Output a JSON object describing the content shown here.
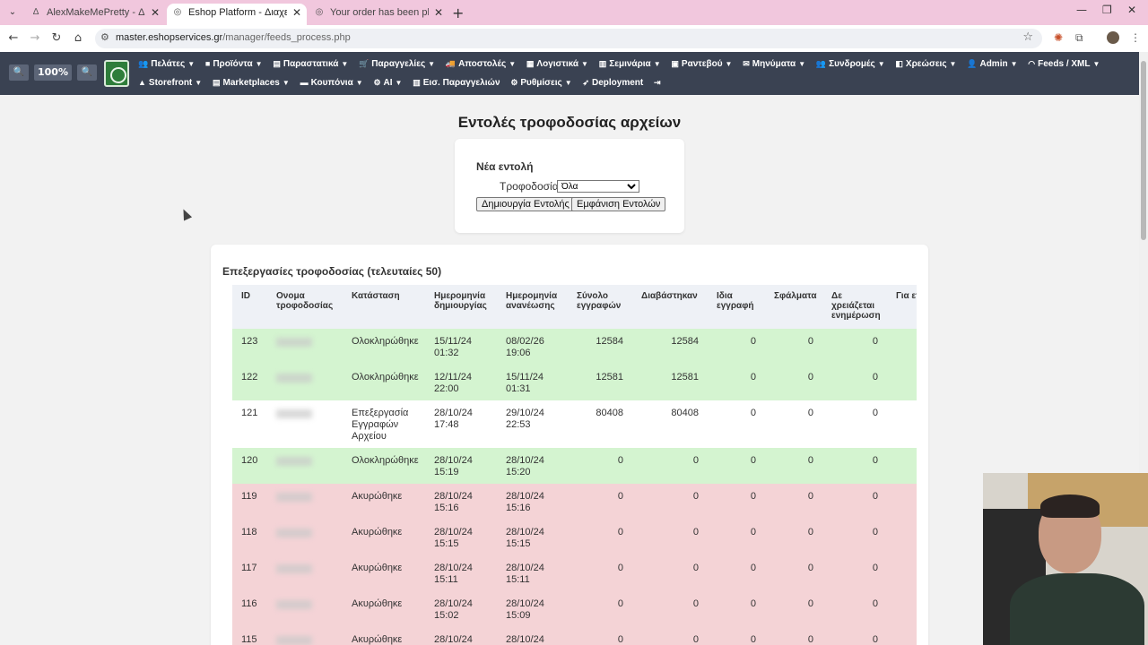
{
  "browser": {
    "tabs": [
      {
        "title": "AlexMakeMePretty - Διαχείριση",
        "icon": "a-icon"
      },
      {
        "title": "Eshop Platform - Διαχείριση Κα",
        "icon": "globe-icon"
      },
      {
        "title": "Your order has been placed!",
        "icon": "globe-icon"
      }
    ],
    "url_host": "master.eshopservices.gr",
    "url_path": "/manager/feeds_process.php"
  },
  "appnav": {
    "zoom": "100%",
    "row1": [
      {
        "label": "Πελάτες",
        "icon": "users-icon"
      },
      {
        "label": "Προϊόντα",
        "icon": "box-icon"
      },
      {
        "label": "Παραστατικά",
        "icon": "document-icon"
      },
      {
        "label": "Παραγγελίες",
        "icon": "cart-icon"
      },
      {
        "label": "Αποστολές",
        "icon": "truck-icon"
      },
      {
        "label": "Λογιστικά",
        "icon": "ledger-icon"
      },
      {
        "label": "Σεμινάρια",
        "icon": "seminar-icon"
      },
      {
        "label": "Ραντεβού",
        "icon": "calendar-icon"
      },
      {
        "label": "Μηνύματα",
        "icon": "mail-icon"
      },
      {
        "label": "Συνδρομές",
        "icon": "group-icon"
      },
      {
        "label": "Χρεώσεις",
        "icon": "billing-icon"
      },
      {
        "label": "Admin",
        "icon": "admin-icon"
      },
      {
        "label": "Feeds / XML",
        "icon": "rss-icon"
      }
    ],
    "row2": [
      {
        "label": "Storefront",
        "icon": "store-icon",
        "caret": true
      },
      {
        "label": "Marketplaces",
        "icon": "marketplace-icon",
        "caret": true
      },
      {
        "label": "Κουπόνια",
        "icon": "coupon-icon",
        "caret": true
      },
      {
        "label": "AI",
        "icon": "ai-icon",
        "caret": true
      },
      {
        "label": "Εισ. Παραγγελιών",
        "icon": "import-icon",
        "caret": false
      },
      {
        "label": "Ρυθμίσεις",
        "icon": "gear-icon",
        "caret": true
      },
      {
        "label": "Deployment",
        "icon": "rocket-icon",
        "caret": false
      }
    ]
  },
  "page": {
    "title": "Εντολές τροφοδοσίας αρχείων",
    "new_command": {
      "heading": "Νέα εντολή",
      "feed_label": "Τροφοδοσία:",
      "feed_value": "Όλα",
      "create_button": "Δημιουργία Εντολής",
      "show_button": "Εμφάνιση Εντολών"
    },
    "list": {
      "heading": "Επεξεργασίες τροφοδοσίας (τελευταίες 50)",
      "columns": [
        "ID",
        "Ονομα τροφοδοσίας",
        "Κατάσταση",
        "Ημερομηνία δημιουργίας",
        "Ημερομηνία ανανέωσης",
        "Σύνολο εγγραφών",
        "Διαβάστηκαν",
        "Ιδια εγγραφή",
        "Σφάλματα",
        "Δε χρειάζεται ενημέρωση",
        "Για επι"
      ],
      "rows": [
        {
          "id": "123",
          "status": "Ολοκληρώθηκε",
          "created": "15/11/24 01:32",
          "updated": "08/02/26 19:06",
          "total": "12584",
          "read": "12584",
          "same": "0",
          "errors": "0",
          "noupdate": "0",
          "state": "done"
        },
        {
          "id": "122",
          "status": "Ολοκληρώθηκε",
          "created": "12/11/24 22:00",
          "updated": "15/11/24 01:31",
          "total": "12581",
          "read": "12581",
          "same": "0",
          "errors": "0",
          "noupdate": "0",
          "state": "done"
        },
        {
          "id": "121",
          "status": "Επεξεργασία Εγγραφών Αρχείου",
          "created": "28/10/24 17:48",
          "updated": "29/10/24 22:53",
          "total": "80408",
          "read": "80408",
          "same": "0",
          "errors": "0",
          "noupdate": "0",
          "state": "proc"
        },
        {
          "id": "120",
          "status": "Ολοκληρώθηκε",
          "created": "28/10/24 15:19",
          "updated": "28/10/24 15:20",
          "total": "0",
          "read": "0",
          "same": "0",
          "errors": "0",
          "noupdate": "0",
          "state": "done"
        },
        {
          "id": "119",
          "status": "Ακυρώθηκε",
          "created": "28/10/24 15:16",
          "updated": "28/10/24 15:16",
          "total": "0",
          "read": "0",
          "same": "0",
          "errors": "0",
          "noupdate": "0",
          "state": "cancel"
        },
        {
          "id": "118",
          "status": "Ακυρώθηκε",
          "created": "28/10/24 15:15",
          "updated": "28/10/24 15:15",
          "total": "0",
          "read": "0",
          "same": "0",
          "errors": "0",
          "noupdate": "0",
          "state": "cancel"
        },
        {
          "id": "117",
          "status": "Ακυρώθηκε",
          "created": "28/10/24 15:11",
          "updated": "28/10/24 15:11",
          "total": "0",
          "read": "0",
          "same": "0",
          "errors": "0",
          "noupdate": "0",
          "state": "cancel"
        },
        {
          "id": "116",
          "status": "Ακυρώθηκε",
          "created": "28/10/24 15:02",
          "updated": "28/10/24 15:09",
          "total": "0",
          "read": "0",
          "same": "0",
          "errors": "0",
          "noupdate": "0",
          "state": "cancel"
        },
        {
          "id": "115",
          "status": "Ακυρώθηκε",
          "created": "28/10/24",
          "updated": "28/10/24",
          "total": "0",
          "read": "0",
          "same": "0",
          "errors": "0",
          "noupdate": "0",
          "state": "cancel"
        }
      ]
    }
  },
  "colors": {
    "navbar": "#3a4252",
    "tabbar": "#f1c7dd",
    "row_done": "#d4f4d0",
    "row_cancel": "#f4d3d6"
  }
}
